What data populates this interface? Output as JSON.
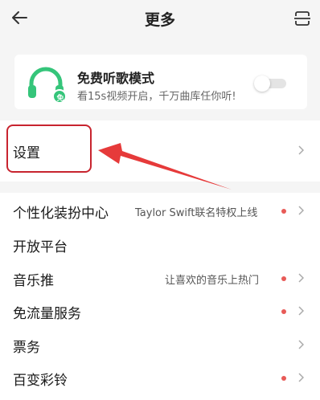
{
  "header": {
    "title": "更多"
  },
  "promo": {
    "title": "免费听歌模式",
    "subtitle": "看15s视频开启，千万曲库任你听!",
    "badge": "免",
    "toggle_on": false
  },
  "settings": {
    "label": "设置"
  },
  "menu": [
    {
      "label": "个性化装扮中心",
      "hint": "Taylor Swift联名特权上线",
      "dot": true,
      "chevron": true
    },
    {
      "label": "开放平台",
      "hint": "",
      "dot": false,
      "chevron": false
    },
    {
      "label": "音乐推",
      "hint": "让喜欢的音乐上热门",
      "dot": true,
      "chevron": true
    },
    {
      "label": "免流量服务",
      "hint": "",
      "dot": true,
      "chevron": true
    },
    {
      "label": "票务",
      "hint": "",
      "dot": false,
      "chevron": true
    },
    {
      "label": "百变彩铃",
      "hint": "",
      "dot": true,
      "chevron": true
    }
  ],
  "colors": {
    "accent_green": "#35c57a",
    "badge_dot": "#e85a57",
    "annotation_red": "#c8242f"
  },
  "icons": {
    "back": "back-arrow-icon",
    "scan": "scan-icon",
    "promo": "headphone-icon",
    "chevron": "chevron-right-icon"
  }
}
